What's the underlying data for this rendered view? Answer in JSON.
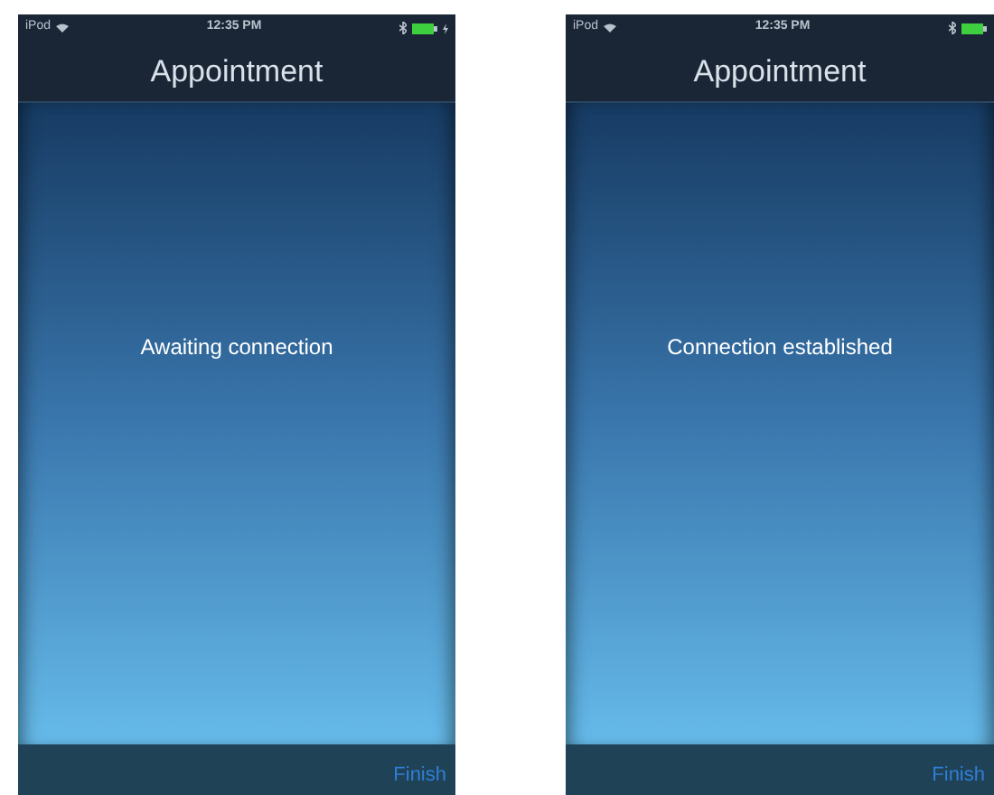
{
  "screens": [
    {
      "status_bar": {
        "carrier": "iPod",
        "time": "12:35 PM",
        "charging": true
      },
      "title": "Appointment",
      "message": "Awaiting connection",
      "toolbar": {
        "button": "Finish"
      }
    },
    {
      "status_bar": {
        "carrier": "iPod",
        "time": "12:35 PM",
        "charging": false
      },
      "title": "Appointment",
      "message": "Connection established",
      "toolbar": {
        "button": "Finish"
      }
    }
  ]
}
